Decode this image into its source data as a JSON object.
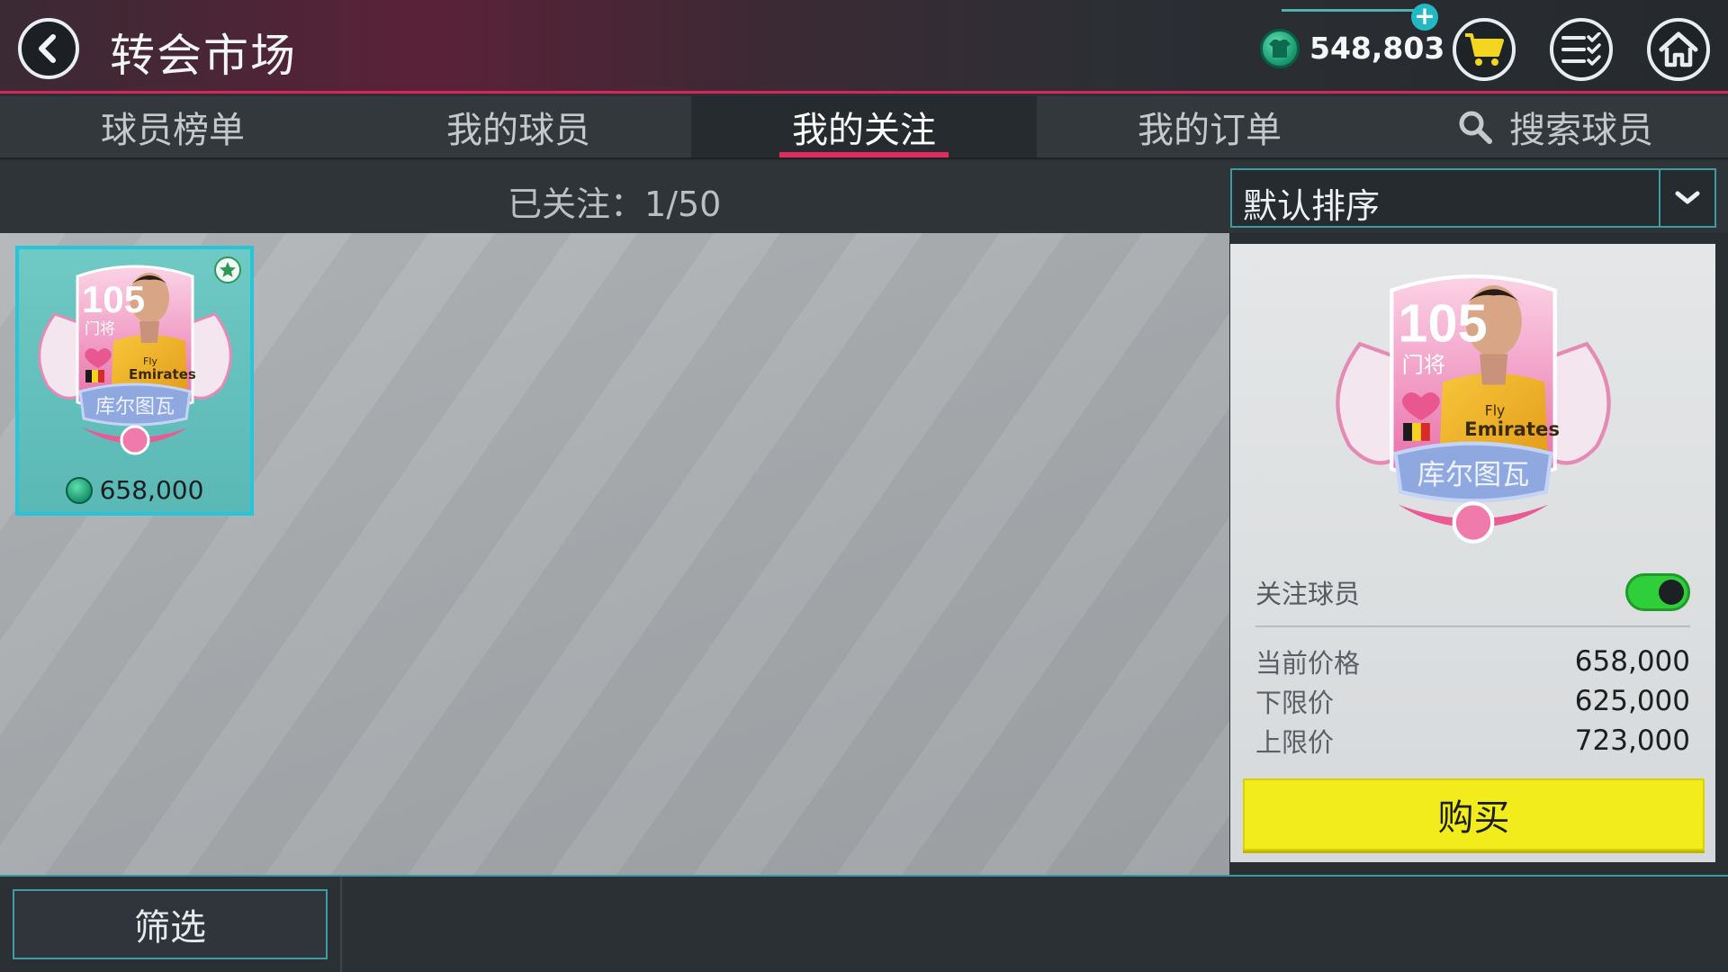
{
  "header": {
    "title": "转会市场",
    "coins": "548,803",
    "back_icon": "chevron-left-icon",
    "cart_icon": "cart-icon",
    "tasks_icon": "checklist-icon",
    "home_icon": "home-icon",
    "plus_icon": "plus-icon"
  },
  "tabs": [
    {
      "label": "球员榜单"
    },
    {
      "label": "我的球员"
    },
    {
      "label": "我的关注",
      "active": true
    },
    {
      "label": "我的订单"
    },
    {
      "label": "搜索球员",
      "icon": "search-icon"
    }
  ],
  "watchlist": {
    "counter_label": "已关注：",
    "counter_value": "1/50",
    "sort_selected": "默认排序"
  },
  "players": [
    {
      "rating": "105",
      "position": "门将",
      "name": "库尔图瓦",
      "price": "658,000",
      "sponsor_line1": "Fly",
      "sponsor_line2": "Emirates",
      "watched": true
    }
  ],
  "detail": {
    "rating": "105",
    "position": "门将",
    "name": "库尔图瓦",
    "sponsor_line1": "Fly",
    "sponsor_line2": "Emirates",
    "follow_label": "关注球员",
    "follow_on": true,
    "rows": [
      {
        "label": "当前价格",
        "value": "658,000"
      },
      {
        "label": "下限价",
        "value": "625,000"
      },
      {
        "label": "上限价",
        "value": "723,000"
      }
    ],
    "buy_label": "购买"
  },
  "footer": {
    "filter_label": "筛选"
  },
  "colors": {
    "accent_pink": "#e02b5e",
    "accent_teal": "#3f9ba0",
    "buy_yellow": "#f3ec1d",
    "toggle_green": "#2fcf3b"
  }
}
